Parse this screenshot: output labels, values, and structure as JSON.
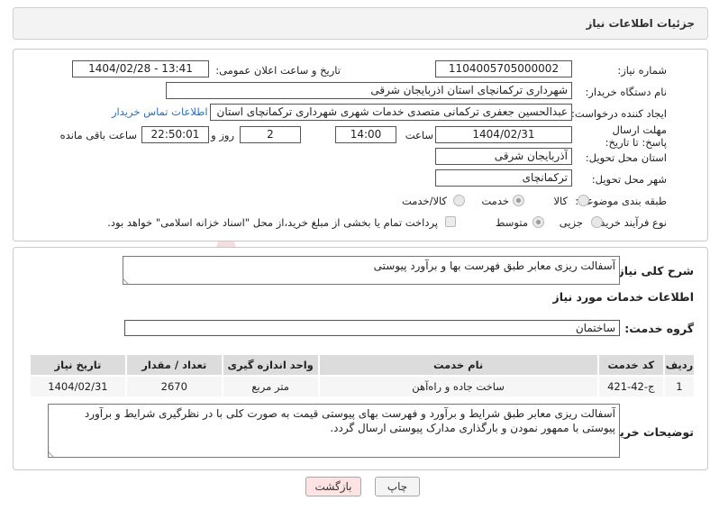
{
  "header": {
    "title": "جزئیات اطلاعات نیاز"
  },
  "form": {
    "need_number_label": "شماره نیاز:",
    "need_number": "1104005705000002",
    "announce_label": "تاریخ و ساعت اعلان عمومی:",
    "announce_value": "1404/02/28 - 13:41",
    "buyer_org_label": "نام دستگاه خریدار:",
    "buyer_org": "شهرداری ترکمانچای استان اذربایجان شرقی",
    "creator_label": "ایجاد کننده درخواست:",
    "creator": "عبدالحسین  جعفری ترکمانی  متصدی خدمات شهری  شهرداری ترکمانچای استان",
    "contact_link": "اطلاعات تماس خریدار",
    "deadline_label": "مهلت ارسال پاسخ: تا تاریخ:",
    "deadline_date": "1404/02/31",
    "time_label": "ساعت",
    "deadline_time": "14:00",
    "days_value": "2",
    "days_label": "روز و",
    "remaining_time": "22:50:01",
    "remaining_label": "ساعت باقی مانده",
    "province_label": "استان محل تحویل:",
    "province": "آذربایجان شرقی",
    "city_label": "شهر محل تحویل:",
    "city": "ترکمانچای",
    "category_label": "طبقه بندی موضوعی:",
    "category_options": [
      "کالا",
      "خدمت",
      "کالا/خدمت"
    ],
    "category_selected": "خدمت",
    "process_label": "نوع فرآیند خرید :",
    "process_options": [
      "جزیی",
      "متوسط"
    ],
    "process_selected": "متوسط",
    "treasury_note": "پرداخت تمام یا بخشی از مبلغ خرید،از محل \"اسناد خزانه اسلامی\" خواهد بود."
  },
  "summary": {
    "label": "شرح کلی نیاز:",
    "value": "آسفالت ریزی معابر طبق فهرست بها و برآورد پیوستی"
  },
  "services": {
    "section_title": "اطلاعات خدمات مورد نیاز",
    "group_label": "گروه خدمت:",
    "group_value": "ساختمان",
    "columns": [
      "ردیف",
      "کد خدمت",
      "نام خدمت",
      "واحد اندازه گیری",
      "تعداد / مقدار",
      "تاریخ نیاز"
    ],
    "rows": [
      [
        "1",
        "ج-42-421",
        "ساخت جاده و راه‌آهن",
        "متر مربع",
        "2670",
        "1404/02/31"
      ]
    ]
  },
  "buyer_notes": {
    "label": "توضیحات خریدار:",
    "value": "آسفالت ریزی معابر طبق شرایط و برآورد و فهرست بهای پیوستی قیمت به صورت کلی با در نظرگیری شرایط و برآورد پیوستی با ممهور نمودن و بارگذاری مدارک پیوستی ارسال گردد."
  },
  "buttons": {
    "print": "چاپ",
    "back": "بازگشت"
  },
  "watermark": "AriaTender.net",
  "colors": {
    "link": "#2a6ebb",
    "back_button_bg": "#fde3e3",
    "watermark": "#c0392b"
  }
}
